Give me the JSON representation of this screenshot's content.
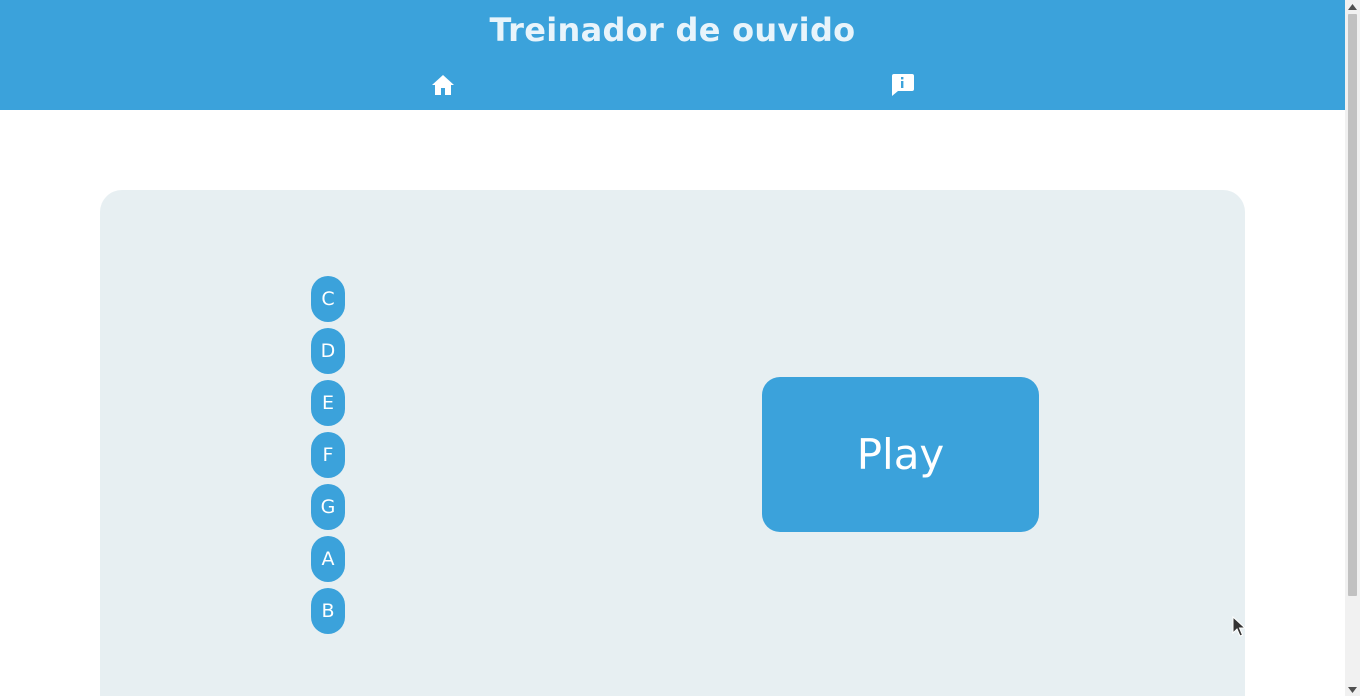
{
  "header": {
    "title": "Treinador de ouvido",
    "nav": [
      {
        "icon": "home-icon"
      },
      {
        "icon": "info-icon"
      }
    ]
  },
  "notes": [
    "C",
    "D",
    "E",
    "F",
    "G",
    "A",
    "B"
  ],
  "play_label": "Play",
  "colors": {
    "accent": "#3ba2db",
    "panel": "#e7eff2",
    "title_text": "#e8f4fb"
  }
}
